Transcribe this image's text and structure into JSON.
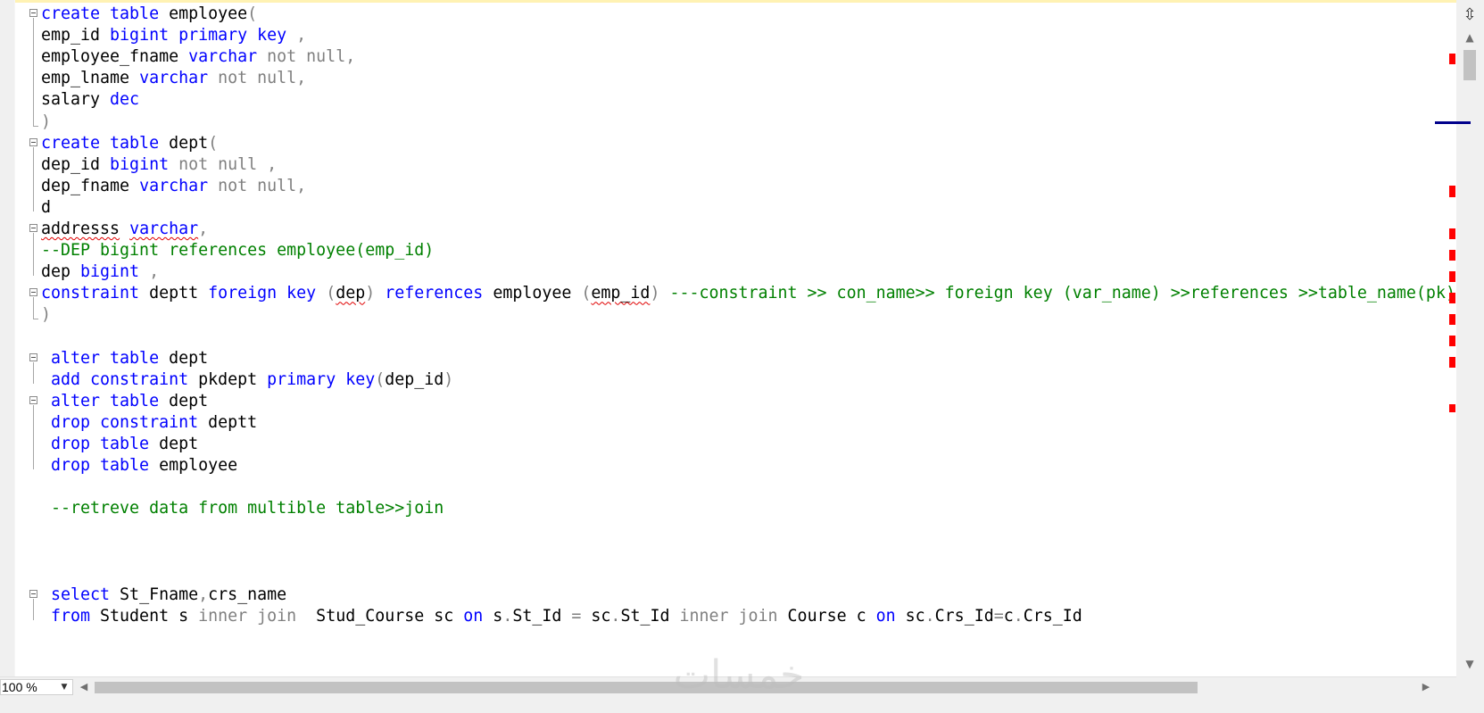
{
  "editor": {
    "lines": [
      [
        {
          "t": "create table",
          "c": "k"
        },
        {
          "t": " employee",
          "c": "t"
        },
        {
          "t": "(",
          "c": "g"
        }
      ],
      [
        {
          "t": "emp_id ",
          "c": "t"
        },
        {
          "t": "bigint primary key",
          "c": "k"
        },
        {
          "t": " ,",
          "c": "g"
        }
      ],
      [
        {
          "t": "employee_fname ",
          "c": "t"
        },
        {
          "t": "varchar",
          "c": "k"
        },
        {
          "t": " not null,",
          "c": "g"
        }
      ],
      [
        {
          "t": "emp_lname ",
          "c": "t"
        },
        {
          "t": "varchar",
          "c": "k"
        },
        {
          "t": " not null,",
          "c": "g"
        }
      ],
      [
        {
          "t": "salary ",
          "c": "t"
        },
        {
          "t": "dec",
          "c": "k"
        }
      ],
      [
        {
          "t": ")",
          "c": "g"
        }
      ],
      [
        {
          "t": "create table",
          "c": "k"
        },
        {
          "t": " dept",
          "c": "t"
        },
        {
          "t": "(",
          "c": "g"
        }
      ],
      [
        {
          "t": "dep_id ",
          "c": "t"
        },
        {
          "t": "bigint",
          "c": "k"
        },
        {
          "t": " not null ,",
          "c": "g"
        }
      ],
      [
        {
          "t": "dep_fname ",
          "c": "t"
        },
        {
          "t": "varchar",
          "c": "k"
        },
        {
          "t": " not null,",
          "c": "g"
        }
      ],
      [
        {
          "t": "d",
          "c": "t"
        }
      ],
      [
        {
          "t": "addresss",
          "c": "t",
          "sq": true
        },
        {
          "t": " ",
          "c": "t"
        },
        {
          "t": "varchar",
          "c": "k",
          "sq": true
        },
        {
          "t": ",",
          "c": "g"
        }
      ],
      [
        {
          "t": "--DEP bigint references employee(emp_id)",
          "c": "c"
        }
      ],
      [
        {
          "t": "dep ",
          "c": "t"
        },
        {
          "t": "bigint",
          "c": "k"
        },
        {
          "t": " ,",
          "c": "g"
        }
      ],
      [
        {
          "t": "constraint",
          "c": "k"
        },
        {
          "t": " deptt ",
          "c": "t"
        },
        {
          "t": "foreign key",
          "c": "k"
        },
        {
          "t": " (",
          "c": "g"
        },
        {
          "t": "dep",
          "c": "t",
          "sq": true
        },
        {
          "t": ") ",
          "c": "g"
        },
        {
          "t": "references",
          "c": "k"
        },
        {
          "t": " employee ",
          "c": "t"
        },
        {
          "t": "(",
          "c": "g"
        },
        {
          "t": "emp_id",
          "c": "t",
          "sq": true
        },
        {
          "t": ") ",
          "c": "g"
        },
        {
          "t": "---constraint >> con_name>> foreign key (var_name) >>references >>table_name(pk)",
          "c": "c"
        }
      ],
      [
        {
          "t": ")",
          "c": "g"
        }
      ],
      [],
      [
        {
          "t": " alter table",
          "c": "k"
        },
        {
          "t": " dept",
          "c": "t"
        }
      ],
      [
        {
          "t": " add constraint",
          "c": "k"
        },
        {
          "t": " pkdept ",
          "c": "t"
        },
        {
          "t": "primary key",
          "c": "k"
        },
        {
          "t": "(",
          "c": "g"
        },
        {
          "t": "dep_id",
          "c": "t"
        },
        {
          "t": ")",
          "c": "g"
        }
      ],
      [
        {
          "t": " alter table",
          "c": "k"
        },
        {
          "t": " dept",
          "c": "t"
        }
      ],
      [
        {
          "t": " drop constraint",
          "c": "k"
        },
        {
          "t": " deptt",
          "c": "t"
        }
      ],
      [
        {
          "t": " drop table",
          "c": "k"
        },
        {
          "t": " dept",
          "c": "t"
        }
      ],
      [
        {
          "t": " drop table",
          "c": "k"
        },
        {
          "t": " employee",
          "c": "t"
        }
      ],
      [],
      [
        {
          "t": " --retreve data from multible table>>join",
          "c": "c"
        }
      ],
      [],
      [],
      [],
      [
        {
          "t": " select",
          "c": "k"
        },
        {
          "t": " St_Fname",
          "c": "t"
        },
        {
          "t": ",",
          "c": "g"
        },
        {
          "t": "crs_name",
          "c": "t"
        }
      ],
      [
        {
          "t": " from",
          "c": "k"
        },
        {
          "t": " Student s ",
          "c": "t"
        },
        {
          "t": "inner join",
          "c": "g"
        },
        {
          "t": "  Stud_Course sc ",
          "c": "t"
        },
        {
          "t": "on",
          "c": "k"
        },
        {
          "t": " s",
          "c": "t"
        },
        {
          "t": ".",
          "c": "g"
        },
        {
          "t": "St_Id ",
          "c": "t"
        },
        {
          "t": "=",
          "c": "g"
        },
        {
          "t": " sc",
          "c": "t"
        },
        {
          "t": ".",
          "c": "g"
        },
        {
          "t": "St_Id ",
          "c": "t"
        },
        {
          "t": "inner join",
          "c": "g"
        },
        {
          "t": " Course c ",
          "c": "t"
        },
        {
          "t": "on",
          "c": "k"
        },
        {
          "t": " sc",
          "c": "t"
        },
        {
          "t": ".",
          "c": "g"
        },
        {
          "t": "Crs_Id",
          "c": "t"
        },
        {
          "t": "=",
          "c": "g"
        },
        {
          "t": "c",
          "c": "t"
        },
        {
          "t": ".",
          "c": "g"
        },
        {
          "t": "Crs_Id",
          "c": "t"
        }
      ]
    ],
    "fold_lines": [
      0,
      6,
      10,
      13,
      16,
      18,
      27
    ]
  },
  "status": {
    "zoom_label": "100 %"
  },
  "watermark": {
    "text": "خمسات"
  },
  "colors": {
    "keyword": "#0000ff",
    "comment": "#008000",
    "operator": "#808080",
    "error": "#ff0000",
    "scroll_position": "#00008b"
  },
  "icons": {
    "split": "split-window-icon",
    "scroll_up": "chevron-up-icon",
    "scroll_down": "chevron-down-icon",
    "scroll_left": "chevron-left-icon",
    "scroll_right": "chevron-right-icon",
    "zoom_dropdown": "chevron-down-icon",
    "fold": "collapse-icon"
  }
}
